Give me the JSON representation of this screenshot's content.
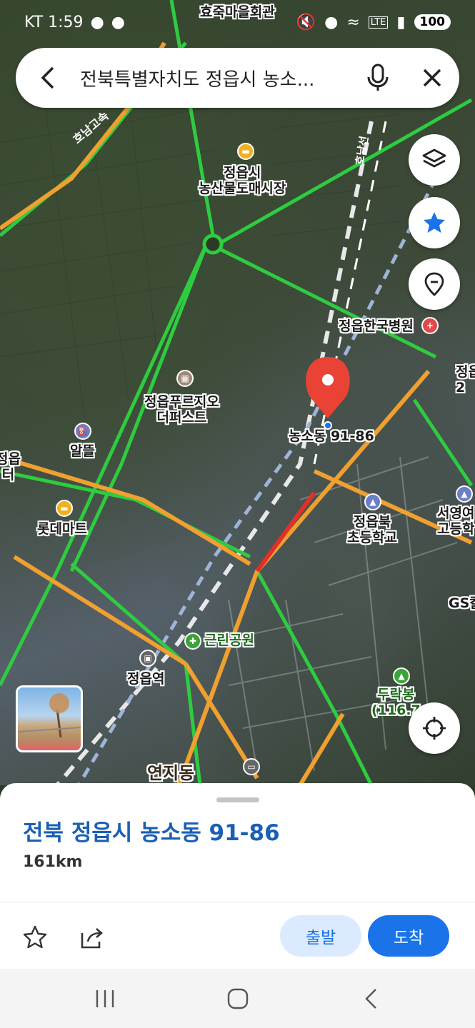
{
  "status": {
    "carrier_time": "KT 1:59",
    "battery": "100",
    "network": "LTE"
  },
  "search": {
    "query": "전북특별자치도 정읍시 농소..."
  },
  "map": {
    "labels": {
      "top": "효죽마을회관",
      "market": "정읍시\n농산물도매시장",
      "hospital": "정읍한국병원",
      "purgio": "정읍푸르지오\n더퍼스트",
      "pin": "농소동 91-86",
      "altteul": "알뜰",
      "lottemart": "롯데마트",
      "school": "정읍북\n초등학교",
      "highschool": "서영여\n고등학",
      "gs": "GS칼",
      "park": "근린공원",
      "station": "정읍역",
      "peak": "두락봉\n(116.7",
      "district": "연지동",
      "left_edge": "정읍\n터",
      "right_edge": "정읍\n2",
      "road1": "호남고속",
      "road2": "호남선"
    }
  },
  "sheet": {
    "address": "전북 정읍시 농소동 91-86",
    "distance": "161km",
    "depart_label": "출발",
    "arrive_label": "도착"
  },
  "colors": {
    "accent": "#1a73e8",
    "pin": "#ea4335"
  }
}
